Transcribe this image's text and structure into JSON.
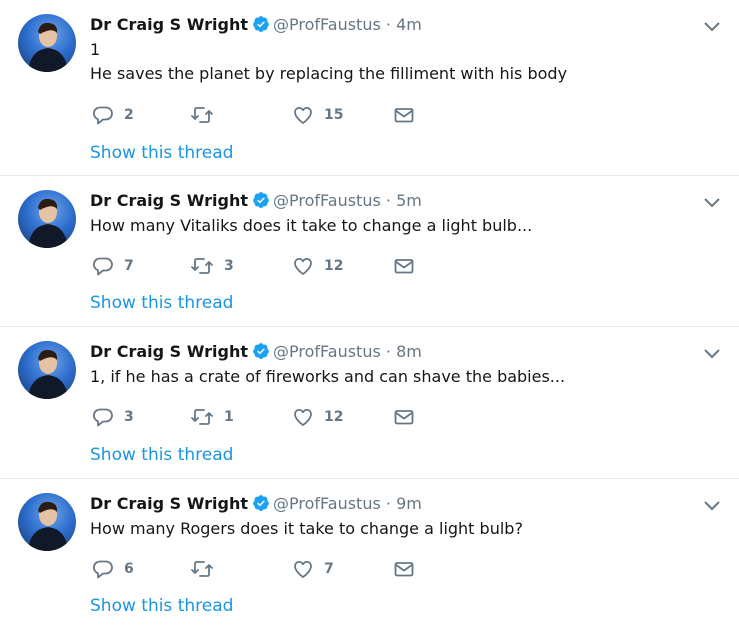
{
  "tweets": [
    {
      "name": "Dr Craig S Wright",
      "handle": "@ProfFaustus",
      "separator": "·",
      "time": "4m",
      "lines": [
        "1",
        "He saves the planet by replacing the filliment with his body"
      ],
      "reply_count": "2",
      "retweet_count": "",
      "like_count": "15",
      "thread_link": "Show this thread"
    },
    {
      "name": "Dr Craig S Wright",
      "handle": "@ProfFaustus",
      "separator": "·",
      "time": "5m",
      "lines": [
        "How many Vitaliks does it take to change a light bulb..."
      ],
      "reply_count": "7",
      "retweet_count": "3",
      "like_count": "12",
      "thread_link": "Show this thread"
    },
    {
      "name": "Dr Craig S Wright",
      "handle": "@ProfFaustus",
      "separator": "·",
      "time": "8m",
      "lines": [
        "1, if he has a crate of fireworks and can shave the babies..."
      ],
      "reply_count": "3",
      "retweet_count": "1",
      "like_count": "12",
      "thread_link": "Show this thread"
    },
    {
      "name": "Dr Craig S Wright",
      "handle": "@ProfFaustus",
      "separator": "·",
      "time": "9m",
      "lines": [
        "How many Rogers does it take to change a light bulb?"
      ],
      "reply_count": "6",
      "retweet_count": "",
      "like_count": "7",
      "thread_link": "Show this thread"
    }
  ],
  "icons": {
    "verified": "verified-badge-icon",
    "caret": "chevron-down-icon",
    "reply": "reply-icon",
    "retweet": "retweet-icon",
    "like": "heart-icon",
    "dm": "envelope-icon"
  },
  "colors": {
    "link": "#1b95e0",
    "muted": "#657786",
    "verified": "#1da1f2",
    "divider": "#e6ecf0"
  }
}
